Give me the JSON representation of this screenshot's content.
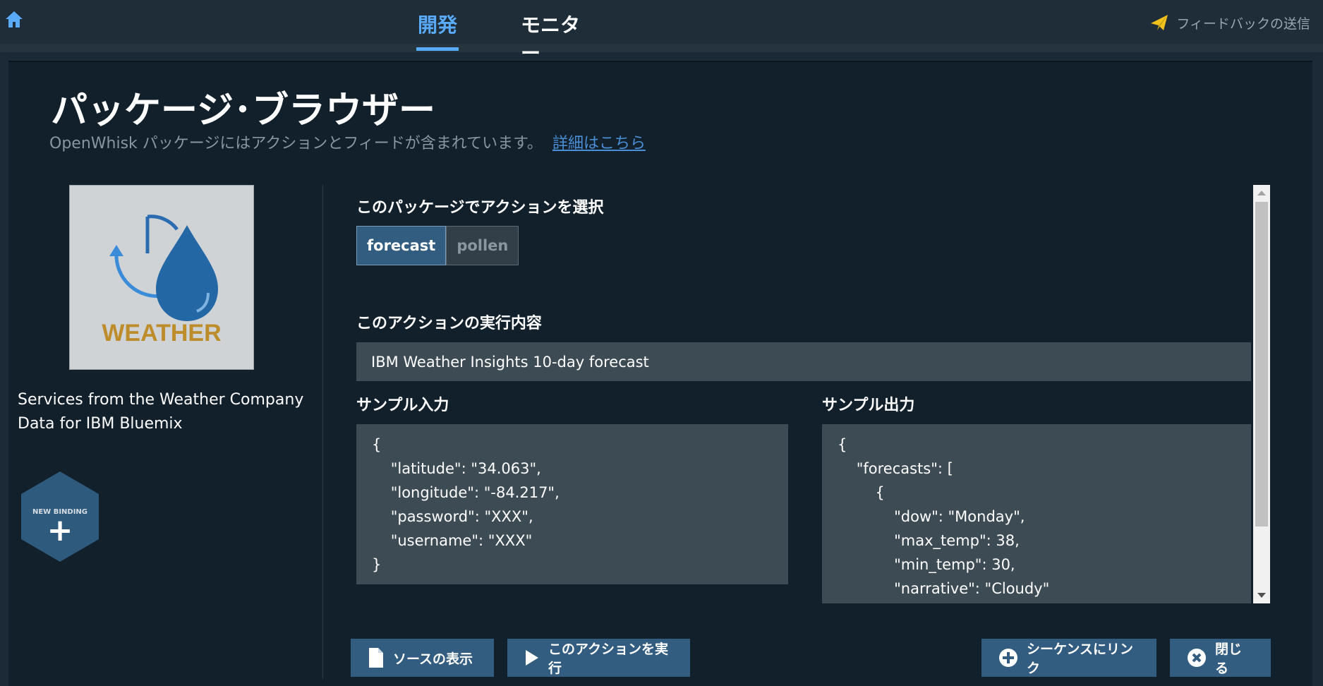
{
  "topbar": {
    "tabs": [
      {
        "label": "開発",
        "active": true
      },
      {
        "label": "モニター",
        "active": false
      }
    ],
    "feedback_label": "フィードバックの送信",
    "accent_color": "#5aaafa"
  },
  "page": {
    "title": "パッケージ･ブラウザー",
    "subtitle": "OpenWhisk パッケージにはアクションとフィードが含まれています。",
    "learn_more": "詳細はこちら"
  },
  "package": {
    "logo_text": "WEATHER",
    "description": "Services from the Weather Company Data for IBM Bluemix",
    "new_binding_label": "NEW BINDING",
    "new_binding_plus": "+"
  },
  "actions": {
    "select_label": "このパッケージでアクションを選択",
    "tabs": [
      {
        "label": "forecast",
        "selected": true
      },
      {
        "label": "pollen",
        "selected": false
      }
    ],
    "description_label": "このアクションの実行内容",
    "description": "IBM Weather Insights 10-day forecast",
    "sample_input_label": "サンプル入力",
    "sample_output_label": "サンプル出力",
    "sample_input": "{\n    \"latitude\": \"34.063\",\n    \"longitude\": \"-84.217\",\n    \"password\": \"XXX\",\n    \"username\": \"XXX\"\n}",
    "sample_output": "{\n    \"forecasts\": [\n        {\n            \"dow\": \"Monday\",\n            \"max_temp\": 38,\n            \"min_temp\": 30,\n            \"narrative\": \"Cloudy\""
  },
  "buttons": {
    "view_source": "ソースの表示",
    "run_action": "このアクションを実行",
    "link_sequence": "シーケンスにリンク",
    "close": "閉じる"
  }
}
